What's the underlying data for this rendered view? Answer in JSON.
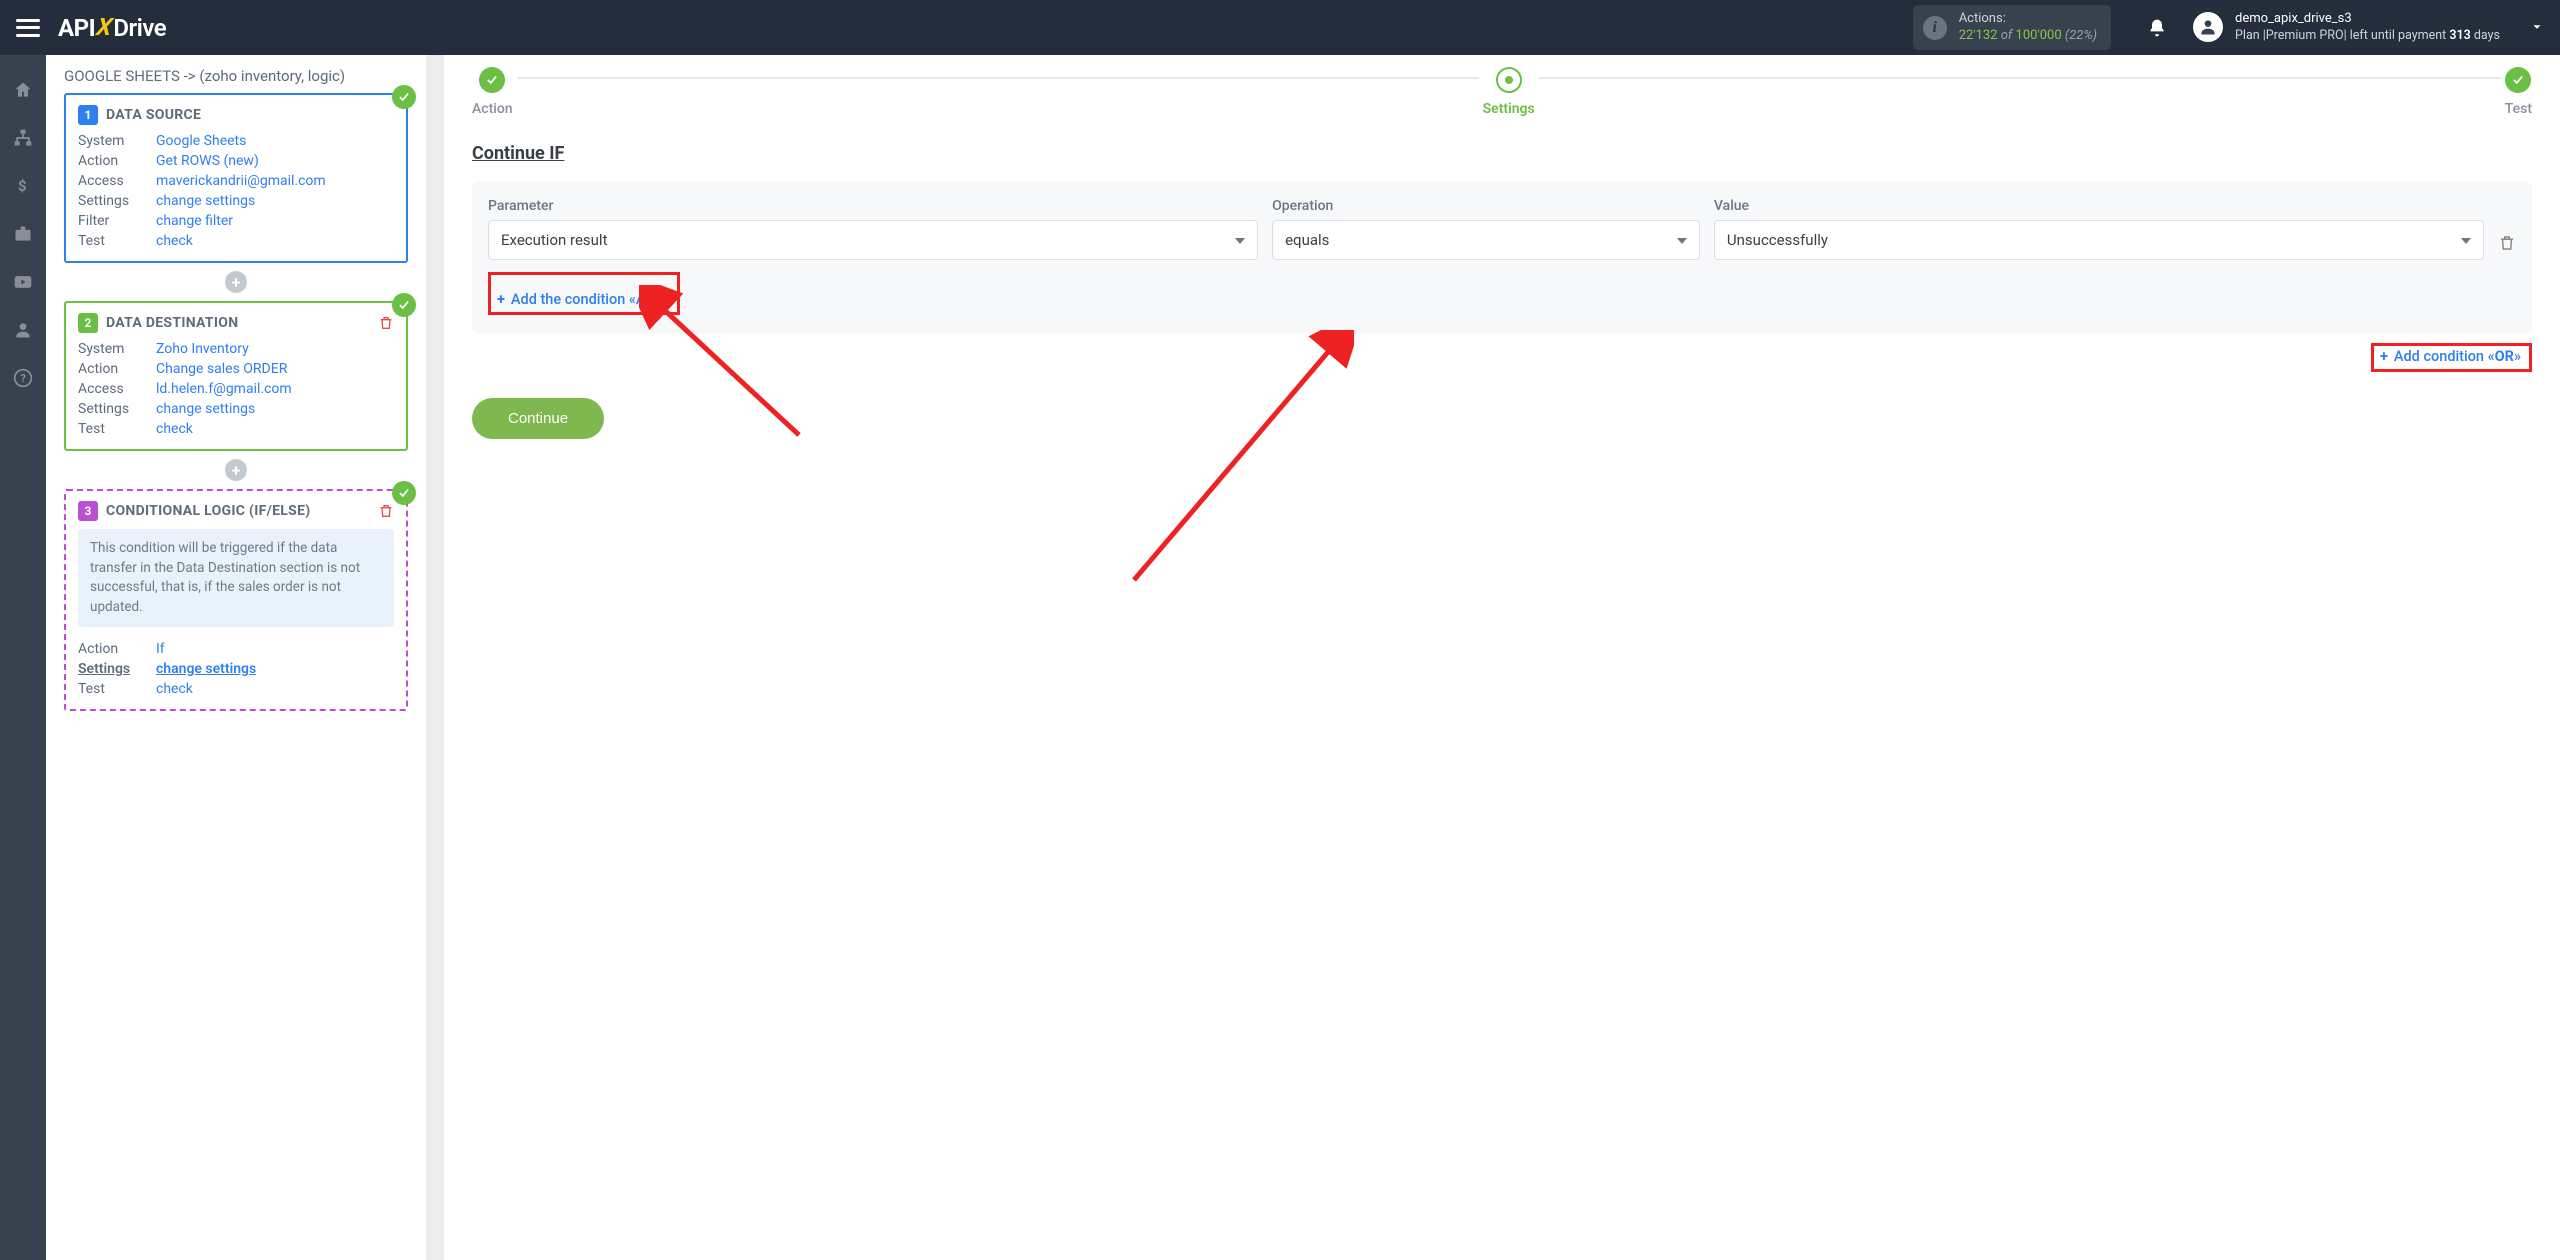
{
  "topbar": {
    "logo": {
      "api": "API",
      "x": "X",
      "drive": "Drive"
    },
    "actions": {
      "label": "Actions:",
      "used": "22'132",
      "of": "of",
      "max": "100'000",
      "pct": "(22%)"
    },
    "user": {
      "name": "demo_apix_drive_s3",
      "plan_prefix": "Plan |Premium PRO| left until payment ",
      "days_num": "313",
      "days_suffix": " days"
    }
  },
  "breadcrumb": "GOOGLE SHEETS -> (zoho inventory, logic)",
  "cards": {
    "source": {
      "num": "1",
      "title": "DATA SOURCE",
      "rows": {
        "system_k": "System",
        "system_v": "Google Sheets",
        "action_k": "Action",
        "action_v": "Get ROWS (new)",
        "access_k": "Access",
        "access_v": "maverickandrii@gmail.com",
        "settings_k": "Settings",
        "settings_v": "change settings",
        "filter_k": "Filter",
        "filter_v": "change filter",
        "test_k": "Test",
        "test_v": "check"
      }
    },
    "dest": {
      "num": "2",
      "title": "DATA DESTINATION",
      "rows": {
        "system_k": "System",
        "system_v": "Zoho Inventory",
        "action_k": "Action",
        "action_v": "Change sales ORDER",
        "access_k": "Access",
        "access_v": "ld.helen.f@gmail.com",
        "settings_k": "Settings",
        "settings_v": "change settings",
        "test_k": "Test",
        "test_v": "check"
      }
    },
    "logic": {
      "num": "3",
      "title": "CONDITIONAL LOGIC (IF/ELSE)",
      "info": "This condition will be triggered if the data transfer in the Data Destination section is not successful, that is, if the sales order is not updated.",
      "rows": {
        "action_k": "Action",
        "action_v": "If",
        "settings_k": "Settings",
        "settings_v": "change settings",
        "test_k": "Test",
        "test_v": "check"
      }
    }
  },
  "steps": {
    "action": "Action",
    "settings": "Settings",
    "test": "Test"
  },
  "right": {
    "section_title": "Continue IF",
    "labels": {
      "parameter": "Parameter",
      "operation": "Operation",
      "value": "Value"
    },
    "values": {
      "parameter": "Execution result",
      "operation": "equals",
      "value": "Unsuccessfully"
    },
    "add_and": "Add the condition «And»",
    "add_or_prefix": "Add condition «",
    "add_or_bold": "OR",
    "add_or_suffix": "»",
    "continue": "Continue"
  }
}
